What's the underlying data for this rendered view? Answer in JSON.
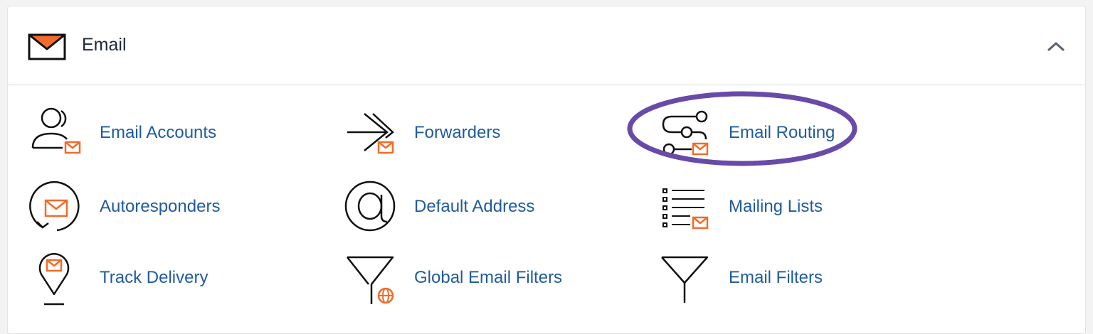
{
  "section": {
    "title": "Email",
    "icon": "envelope-icon",
    "collapse_icon": "chevron-up-icon"
  },
  "items": [
    {
      "label": "Email Accounts",
      "icon": "user-email-icon"
    },
    {
      "label": "Forwarders",
      "icon": "forward-arrow-icon"
    },
    {
      "label": "Email Routing",
      "icon": "routing-icon"
    },
    {
      "label": "Autoresponders",
      "icon": "autoresponder-icon"
    },
    {
      "label": "Default Address",
      "icon": "at-sign-icon"
    },
    {
      "label": "Mailing Lists",
      "icon": "list-icon"
    },
    {
      "label": "Track Delivery",
      "icon": "location-pin-icon"
    },
    {
      "label": "Global Email Filters",
      "icon": "filter-globe-icon"
    },
    {
      "label": "Email Filters",
      "icon": "filter-icon"
    }
  ],
  "colors": {
    "accent": "#f26b2a",
    "link": "#1f5b9e",
    "highlight": "#6a4aa8"
  }
}
